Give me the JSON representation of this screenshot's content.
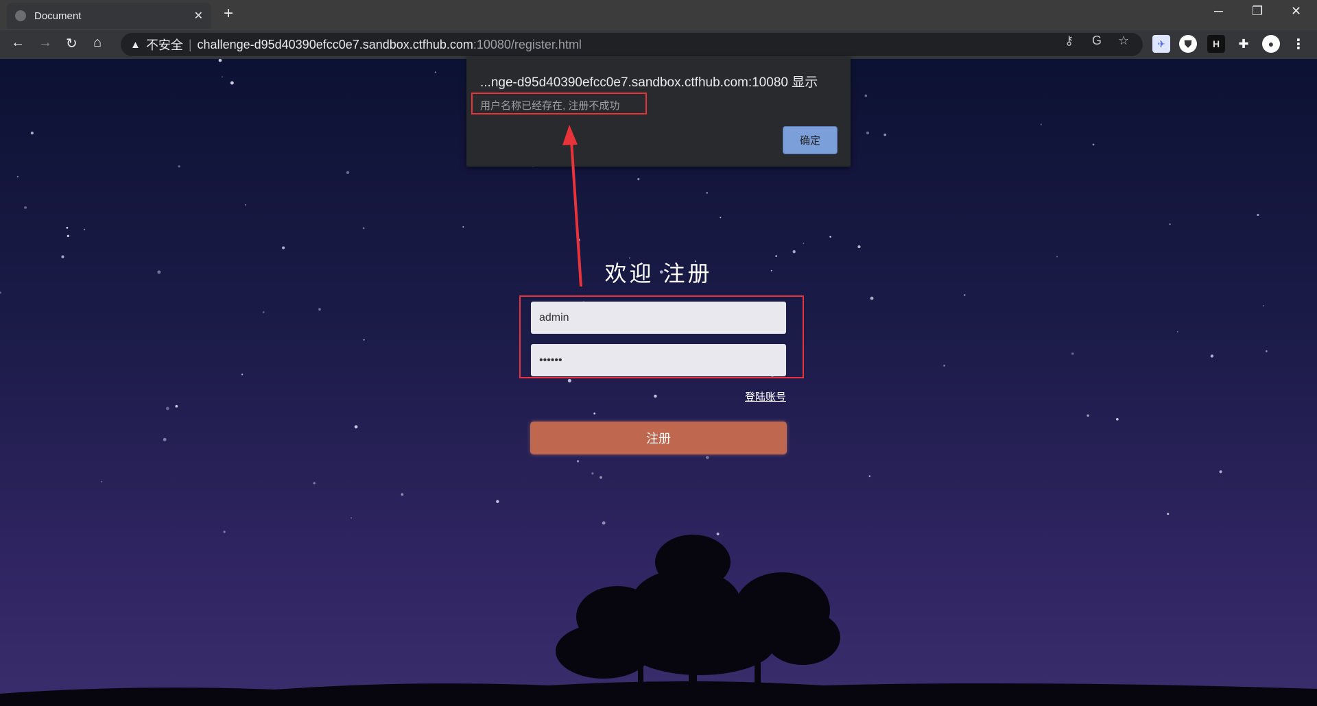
{
  "browser": {
    "tab_title": "Document",
    "security_label": "不安全",
    "url_host": "challenge-d95d40390efcc0e7.sandbox.ctfhub.com",
    "url_rest": ":10080/register.html"
  },
  "dialog": {
    "title": "...nge-d95d40390efcc0e7.sandbox.ctfhub.com:10080 显示",
    "message": "用户名称已经存在, 注册不成功",
    "ok_label": "确定"
  },
  "form": {
    "title": "欢迎 注册",
    "username_value": "admin",
    "password_value": "••••••",
    "login_link": "登陆账号",
    "submit_label": "注册"
  },
  "colors": {
    "submit": "#c0684f",
    "annotation": "#e8333a",
    "dialog_ok": "#7b9fd9"
  }
}
